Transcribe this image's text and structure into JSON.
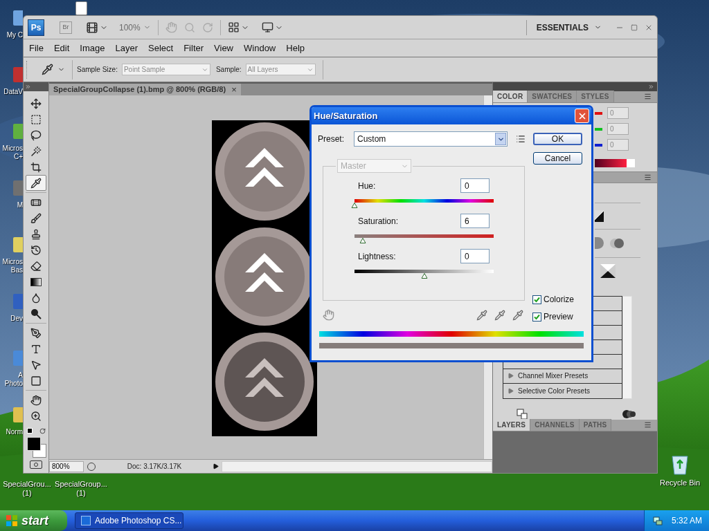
{
  "desktop": {
    "left_icons": [
      {
        "lines": [
          "My C"
        ]
      },
      {
        "lines": [
          "DataV"
        ]
      },
      {
        "lines": [
          "Micros",
          "C+"
        ]
      },
      {
        "lines": [
          "M"
        ]
      },
      {
        "lines": [
          "Micros",
          "Bas"
        ]
      },
      {
        "lines": [
          "Dev"
        ]
      },
      {
        "lines": [
          "A",
          "Photo"
        ]
      },
      {
        "lines": [
          "Norm"
        ]
      }
    ],
    "bottom_icons": [
      {
        "lines": [
          "SpecialGrou...",
          "(1)"
        ]
      },
      {
        "lines": [
          "SpecialGroup...",
          "(1)"
        ]
      }
    ],
    "recycle_bin": {
      "label": "Recycle Bin"
    }
  },
  "photoshop": {
    "app_bar": {
      "logo": "Ps",
      "bridge": "Br",
      "zoom": "100%",
      "workspace": "ESSENTIALS"
    },
    "menu": [
      "File",
      "Edit",
      "Image",
      "Layer",
      "Select",
      "Filter",
      "View",
      "Window",
      "Help"
    ],
    "options": {
      "sample_size_label": "Sample Size:",
      "sample_size": "Point Sample",
      "sample_label": "Sample:",
      "sample": "All Layers"
    },
    "tool_groups": [
      {
        "tools": [
          {
            "kind": "move",
            "selected": false
          },
          {
            "kind": "marquee",
            "selected": false
          },
          {
            "kind": "lasso",
            "selected": false
          },
          {
            "kind": "wand",
            "selected": false
          },
          {
            "kind": "crop",
            "selected": false
          },
          {
            "kind": "eyedropper",
            "selected": true
          }
        ]
      },
      {
        "tools": [
          {
            "kind": "heal",
            "selected": false
          },
          {
            "kind": "brush",
            "selected": false
          },
          {
            "kind": "stamp",
            "selected": false
          },
          {
            "kind": "history",
            "selected": false
          },
          {
            "kind": "eraser",
            "selected": false
          },
          {
            "kind": "gradient",
            "selected": false
          },
          {
            "kind": "blur",
            "selected": false
          },
          {
            "kind": "dodge",
            "selected": false
          }
        ]
      },
      {
        "tools": [
          {
            "kind": "pen",
            "selected": false
          },
          {
            "kind": "type",
            "selected": false
          },
          {
            "kind": "select",
            "selected": false
          },
          {
            "kind": "shape",
            "selected": false
          }
        ]
      },
      {
        "tools": [
          {
            "kind": "hand",
            "selected": false
          },
          {
            "kind": "zoom",
            "selected": false
          }
        ]
      }
    ],
    "document": {
      "tab": "SpecialGroupCollapse (1).bmp @ 800% (RGB/8)",
      "close": "×",
      "zoom": "800%",
      "doc_size": "Doc: 3.17K/3.17K"
    },
    "color_panel": {
      "tabs": [
        {
          "label": "COLOR",
          "selected": true
        },
        {
          "label": "SWATCHES",
          "selected": false
        },
        {
          "label": "STYLES",
          "selected": false
        }
      ],
      "channels": [
        {
          "color": "#e01010",
          "value": "0"
        },
        {
          "color": "#10c020",
          "value": "0"
        },
        {
          "color": "#1020d0",
          "value": "0"
        }
      ]
    },
    "adjustments_panel": {
      "presets": [
        {
          "label": "Channel Mixer Presets",
          "expanded": false
        },
        {
          "label": "Selective Color Presets",
          "expanded": false
        }
      ]
    },
    "layers_panel": {
      "tabs": [
        {
          "label": "LAYERS",
          "selected": true
        },
        {
          "label": "CHANNELS",
          "selected": false
        },
        {
          "label": "PATHS",
          "selected": false
        }
      ]
    }
  },
  "dialog": {
    "title": "Hue/Saturation",
    "preset_label": "Preset:",
    "preset": "Custom",
    "edit": "Master",
    "edit_disabled": true,
    "sliders": [
      {
        "kind": "hue",
        "label": "Hue:",
        "value": "0",
        "level": 0
      },
      {
        "kind": "saturation",
        "label": "Saturation:",
        "value": "6",
        "level": 0.06
      },
      {
        "kind": "lightness",
        "label": "Lightness:",
        "value": "0",
        "level": 0.5
      }
    ],
    "buttons": [
      {
        "label": "OK",
        "default": true
      },
      {
        "label": "Cancel",
        "default": false
      }
    ],
    "checkboxes": [
      {
        "label": "Colorize",
        "checked": true
      },
      {
        "label": "Preview",
        "checked": true
      }
    ]
  },
  "taskbar": {
    "start": "start",
    "tasks": [
      {
        "label": "Adobe Photoshop CS...",
        "selected": true
      }
    ],
    "clock": "5:32 AM"
  }
}
